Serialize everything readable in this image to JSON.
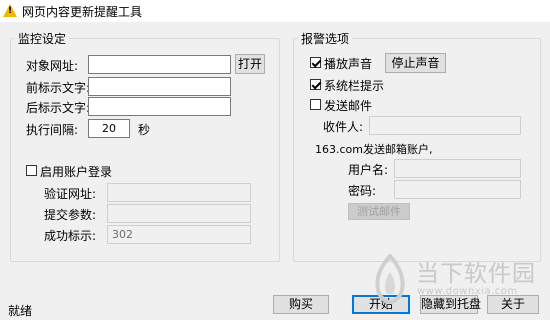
{
  "window": {
    "title": "网页内容更新提醒工具"
  },
  "monitor": {
    "legend": "监控设定",
    "target_url_label": "对象网址:",
    "target_url_value": "",
    "open_button": "打开",
    "prefix_label": "前标示文字:",
    "prefix_value": "",
    "suffix_label": "后标示文字:",
    "suffix_value": "",
    "interval_label": "执行间隔:",
    "interval_value": "20",
    "interval_unit": "秒",
    "login_checkbox_label": "启用账户登录",
    "login_checked": false,
    "verify_url_label": "验证网址:",
    "verify_url_value": "",
    "submit_params_label": "提交参数:",
    "submit_params_value": "",
    "success_flag_label": "成功标示:",
    "success_flag_value": "302"
  },
  "alarm": {
    "legend": "报警选项",
    "play_sound_label": "播放声音",
    "play_sound_checked": true,
    "stop_sound_button": "停止声音",
    "tray_tip_label": "系统栏提示",
    "tray_tip_checked": true,
    "send_mail_label": "发送邮件",
    "send_mail_checked": false,
    "recipient_label": "收件人:",
    "recipient_value": "",
    "account_note": "163.com发送邮箱账户,",
    "username_label": "用户名:",
    "username_value": "",
    "password_label": "密码:",
    "password_value": "",
    "test_mail_button": "测试邮件"
  },
  "footer": {
    "status": "就绪",
    "buy_button": "购买",
    "start_button": "开始",
    "hide_tray_button": "隐藏到托盘",
    "about_button": "关于"
  },
  "watermark": {
    "text": "当下软件园",
    "sub": "www.downxia.com",
    "color": "#c9c9c9"
  },
  "colors": {
    "client_bg": "#f0f0f0",
    "title_icon": "#f2b705",
    "default_button_border": "#0078d7"
  }
}
